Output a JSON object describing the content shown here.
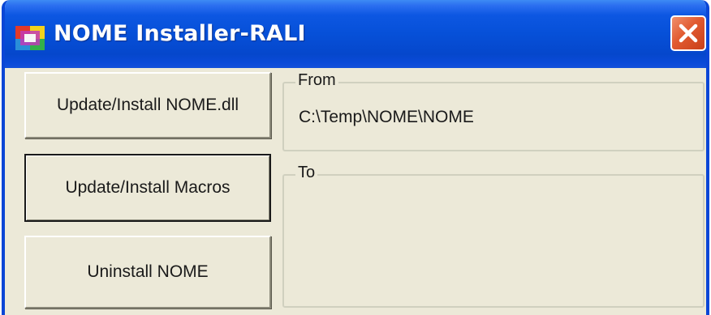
{
  "window": {
    "title": "NOME Installer-RALI",
    "icon": "app-icon",
    "close_icon": "close-icon"
  },
  "buttons": {
    "update_dll": "Update/Install NOME.dll",
    "update_macros": "Update/Install Macros",
    "uninstall": "Uninstall NOME"
  },
  "from_group": {
    "legend": "From",
    "path": "C:\\Temp\\NOME\\NOME"
  },
  "to_group": {
    "legend": "To",
    "path": ""
  },
  "colors": {
    "titlebar": "#0650d8",
    "close": "#e15a30",
    "face": "#ece9d8"
  }
}
